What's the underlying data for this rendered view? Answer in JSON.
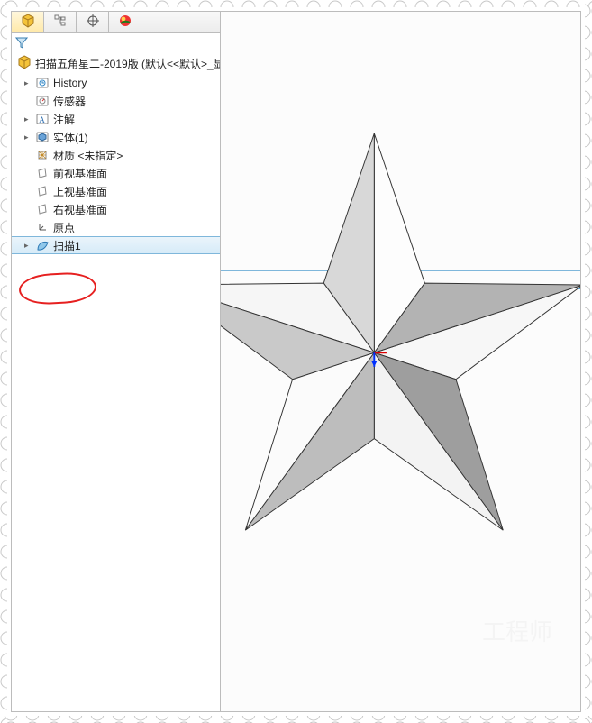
{
  "tabs": {
    "t1": "feature-manager",
    "t2": "property-manager",
    "t3": "configuration-manager",
    "t4": "appearance-manager"
  },
  "root_label": "扫描五角星二-2019版  (默认<<默认>_显",
  "nodes": {
    "history": "History",
    "sensors": "传感器",
    "annotations": "注解",
    "solids": "实体(1)",
    "material": "材质 <未指定>",
    "front": "前视基准面",
    "top": "上视基准面",
    "right": "右视基准面",
    "origin": "原点",
    "sweep": "扫描1"
  },
  "watermark": "工程师"
}
